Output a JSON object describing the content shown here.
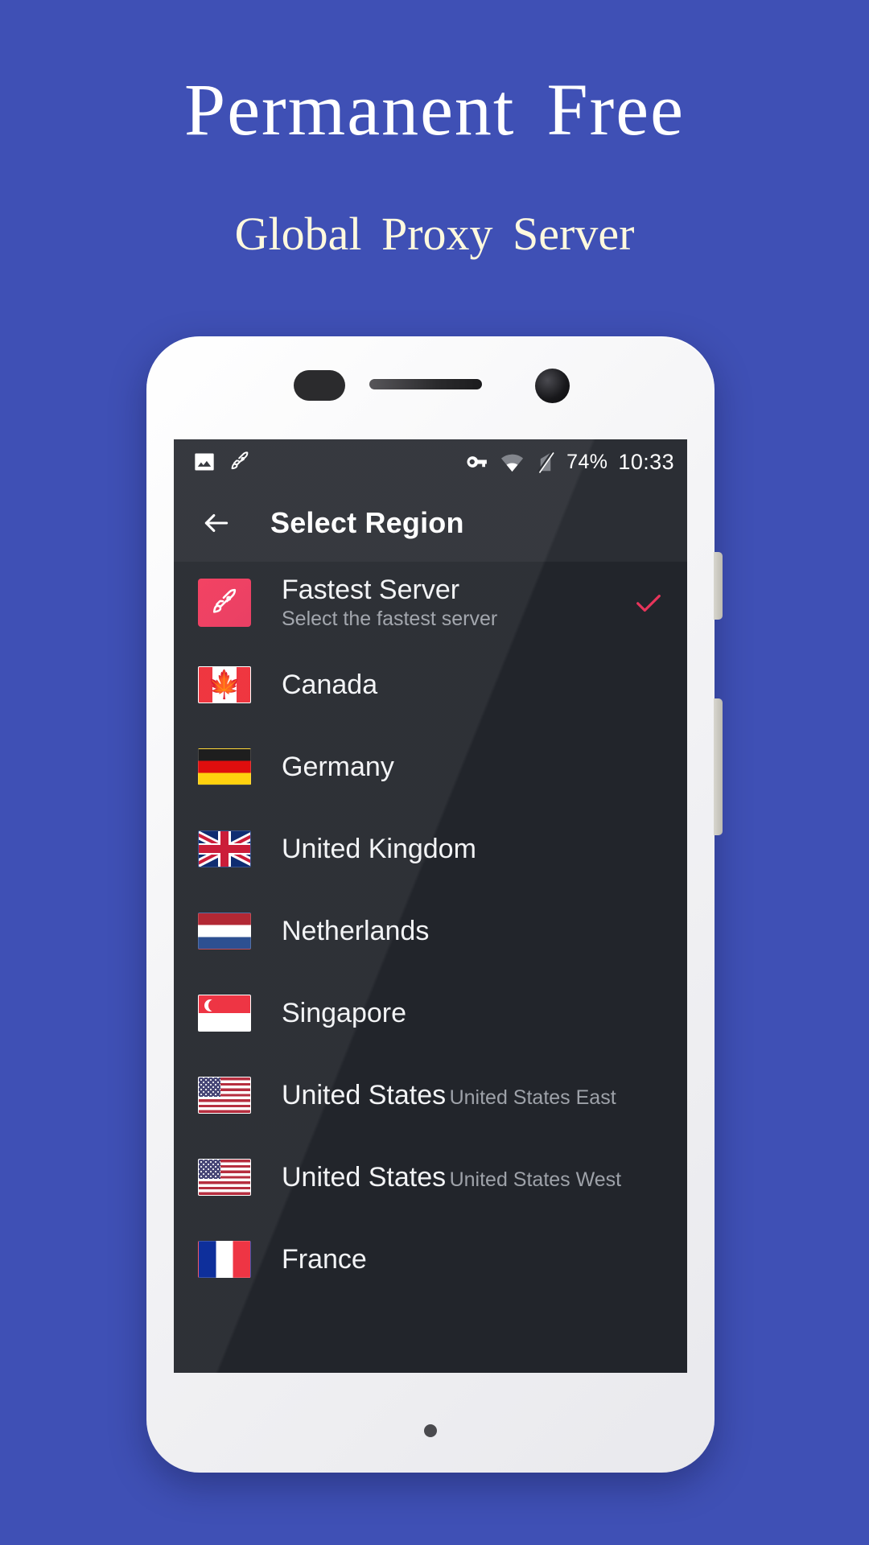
{
  "promo": {
    "headline": "Permanent Free",
    "subheadline": "Global Proxy Server",
    "background_color": "#3F50B5",
    "headline_color": "#FFFFFF",
    "subheadline_color": "#FFF9DE"
  },
  "status_bar": {
    "battery_percent": "74%",
    "time": "10:33",
    "left_icons": [
      "image-icon",
      "rocket-icon"
    ],
    "right_icons": [
      "vpn-key-icon",
      "wifi-icon",
      "signal-off-icon"
    ]
  },
  "toolbar": {
    "back_icon": "back-arrow-icon",
    "title": "Select Region"
  },
  "accent_color": "#E8355B",
  "screen_background": "#22252B",
  "regions": [
    {
      "icon": "rocket-badge",
      "title": "Fastest Server",
      "subtitle": "Select the fastest server",
      "selected": true
    },
    {
      "icon": "flag-ca",
      "title": "Canada",
      "subtitle": "",
      "selected": false
    },
    {
      "icon": "flag-de",
      "title": "Germany",
      "subtitle": "",
      "selected": false
    },
    {
      "icon": "flag-gb",
      "title": "United Kingdom",
      "subtitle": "",
      "selected": false
    },
    {
      "icon": "flag-nl",
      "title": "Netherlands",
      "subtitle": "",
      "selected": false
    },
    {
      "icon": "flag-sg",
      "title": "Singapore",
      "subtitle": "",
      "selected": false
    },
    {
      "icon": "flag-us",
      "title": "United States",
      "subtitle": "United States East",
      "selected": false
    },
    {
      "icon": "flag-us",
      "title": "United States",
      "subtitle": "United States West",
      "selected": false
    },
    {
      "icon": "flag-fr",
      "title": "France",
      "subtitle": "",
      "selected": false
    }
  ]
}
